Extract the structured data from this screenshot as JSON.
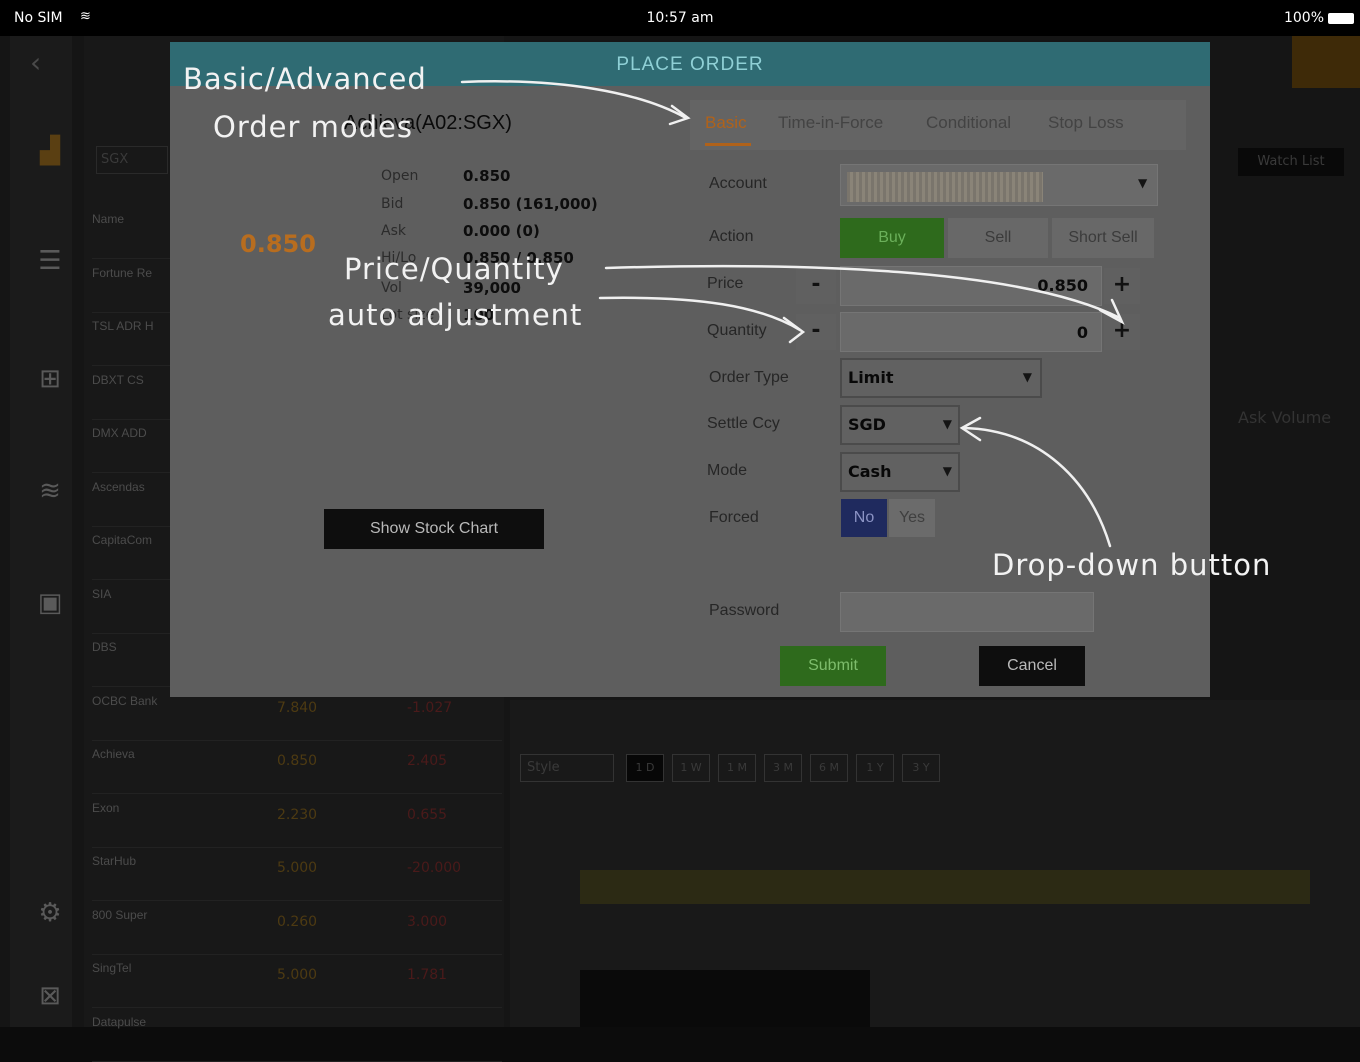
{
  "status_bar": {
    "carrier": "No SIM",
    "wifi": "wifi-icon",
    "time": "10:57 am",
    "battery": "100%"
  },
  "background": {
    "nav": [
      "chart-icon",
      "list-icon",
      "calc-icon",
      "layers-icon",
      "folder-icon",
      "tools-icon",
      "grid-icon"
    ],
    "watchlist": [
      {
        "name": "Name"
      },
      {
        "name": "Fortune Re"
      },
      {
        "name": "TSL ADR H"
      },
      {
        "name": "DBXT CS"
      },
      {
        "name": "DMX ADD"
      },
      {
        "name": "Ascendas"
      },
      {
        "name": "CapitaCom"
      },
      {
        "name": "SIA"
      },
      {
        "name": "DBS"
      },
      {
        "name": "OCBC Bank",
        "price": "7.840",
        "change": "-1.027"
      },
      {
        "name": "Achieva",
        "price": "0.850",
        "change": "2.405"
      },
      {
        "name": "Exon",
        "price": "2.230",
        "change": "0.655"
      },
      {
        "name": "StarHub",
        "price": "5.000",
        "change": "-20.000"
      },
      {
        "name": "800 Super",
        "price": "0.260",
        "change": "3.000"
      },
      {
        "name": "SingTel",
        "price": "5.000",
        "change": "1.781"
      },
      {
        "name": "Datapulse"
      }
    ],
    "timeframes": [
      "1 D",
      "1 W",
      "1 M",
      "3 M",
      "6 M",
      "1 Y",
      "3 Y"
    ],
    "style_label": "Style",
    "ask_volume": "Ask Volume",
    "watchlist_btn": "Watch List"
  },
  "modal": {
    "title": "PLACE ORDER",
    "stock": "Achieva(A02:SGX)",
    "last_price": "0.850",
    "quote": [
      {
        "label": "Open",
        "value": "0.850"
      },
      {
        "label": "Bid",
        "value": "0.850 (161,000)"
      },
      {
        "label": "Ask",
        "value": "0.000 (0)"
      },
      {
        "label": "Hi/Lo",
        "value": "0.850 / 0.850"
      },
      {
        "label": "Vol",
        "value": "39,000"
      },
      {
        "label": "Lot size",
        "value": "100"
      }
    ],
    "show_chart_label": "Show Stock Chart",
    "tabs": [
      "Basic",
      "Time-in-Force",
      "Conditional",
      "Stop Loss"
    ],
    "labels": {
      "account": "Account",
      "action": "Action",
      "price": "Price",
      "quantity": "Quantity",
      "order_type": "Order Type",
      "settle_ccy": "Settle Ccy",
      "mode": "Mode",
      "forced": "Forced",
      "password": "Password"
    },
    "actions": [
      "Buy",
      "Sell",
      "Short Sell"
    ],
    "price_value": "0.850",
    "quantity_value": "0",
    "minus": "-",
    "plus": "+",
    "order_type": "Limit",
    "settle_ccy": "SGD",
    "mode": "Cash",
    "forced": [
      "No",
      "Yes"
    ],
    "submit_label": "Submit",
    "cancel_label": "Cancel"
  },
  "annotations": {
    "order_modes_1": "Basic/Advanced",
    "order_modes_2": "Order modes",
    "price_qty_1": "Price/Quantity",
    "price_qty_2": "auto adjustment",
    "dropdown": "Drop-down button"
  },
  "colors": {
    "header": "#2f6b73",
    "buy": "#2e6a1c",
    "active_tab": "#b0621a",
    "last_price": "#b86d1f",
    "forced_no": "#1f2a5e"
  }
}
